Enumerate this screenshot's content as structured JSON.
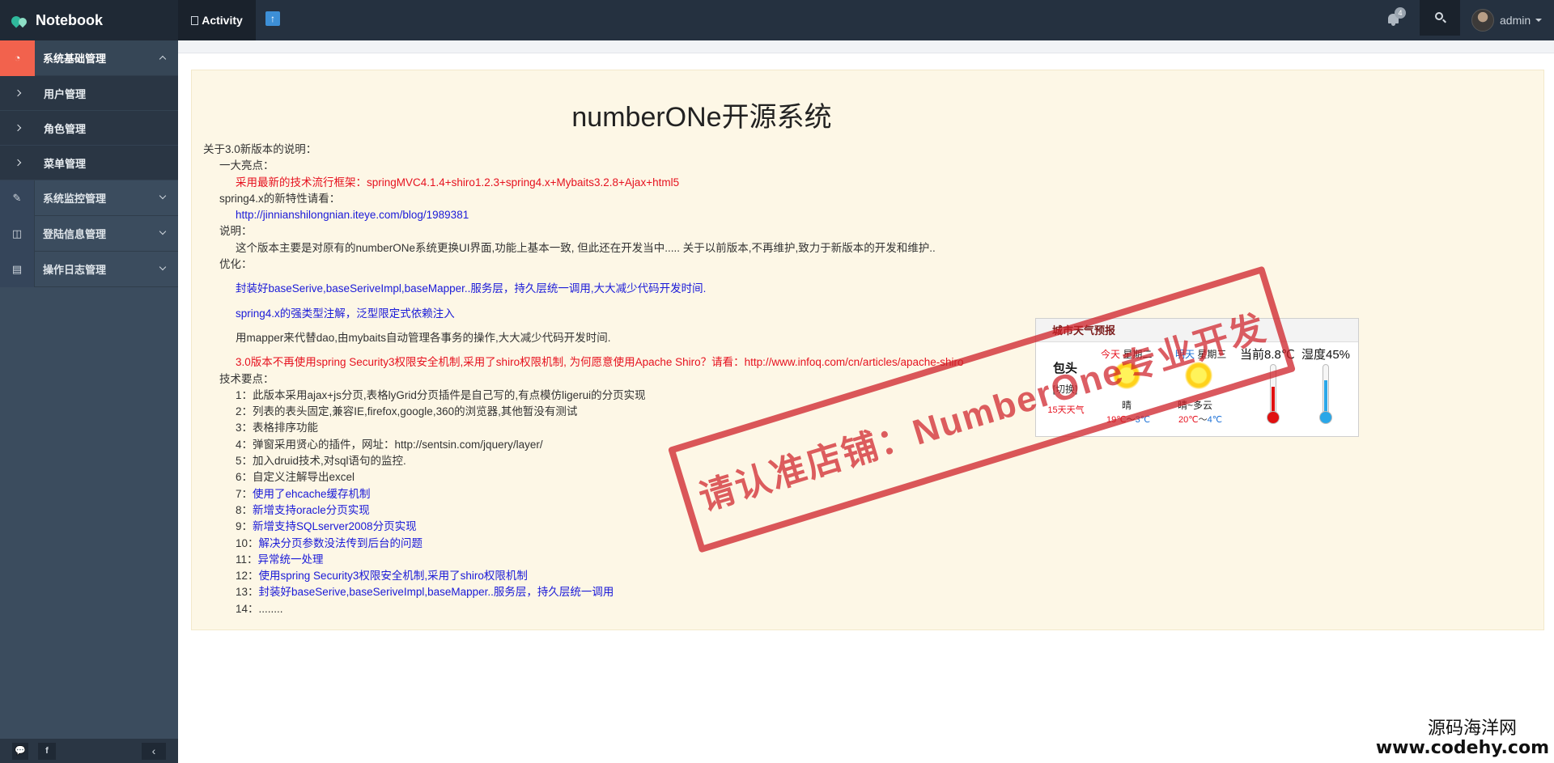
{
  "brand": {
    "title": "Notebook"
  },
  "topnav": {
    "activity_label": "Activity",
    "upload_glyph": "↑",
    "notification_count": "4",
    "user_name": "admin"
  },
  "sidebar": {
    "groups": [
      {
        "label": "系统基础管理",
        "icon": "dashboard-icon",
        "expanded": true,
        "items": [
          {
            "label": "用户管理"
          },
          {
            "label": "角色管理"
          },
          {
            "label": "菜单管理"
          }
        ]
      },
      {
        "label": "系统监控管理",
        "icon": "edit-icon"
      },
      {
        "label": "登陆信息管理",
        "icon": "columns-icon"
      },
      {
        "label": "操作日志管理",
        "icon": "book-icon"
      }
    ],
    "footer": {
      "chat_glyph": "💬",
      "facebook_glyph": "f",
      "collapse_glyph": "‹"
    }
  },
  "content": {
    "title": "numberONe开源系统",
    "lines": [
      "关于3.0新版本的说明：",
      "一大亮点：",
      "采用最新的技术流行框架：springMVC4.1.4+shiro1.2.3+spring4.x+Mybaits3.2.8+Ajax+html5",
      "spring4.x的新特性请看：",
      "http://jinnianshilongnian.iteye.com/blog/1989381",
      "说明：",
      "这个版本主要是对原有的numberONe系统更换UI界面,功能上基本一致, 但此还在开发当中..... 关于以前版本,不再维护,致力于新版本的开发和维护..",
      "优化：",
      "封装好baseSerive,baseSeriveImpl,baseMapper..服务层，持久层统一调用,大大减少代码开发时间.",
      "spring4.x的强类型注解，泛型限定式依赖注入",
      "用mapper来代替dao,由mybaits自动管理各事务的操作,大大减少代码开发时间.",
      "3.0版本不再使用spring Security3权限安全机制,采用了shiro权限机制, 为何愿意使用Apache Shiro？请看：http://www.infoq.com/cn/articles/apache-shiro",
      "技术要点：",
      "1：此版本采用ajax+js分页,表格lyGrid分页插件是自己写的,有点模仿ligerui的分页实现",
      "2：列表的表头固定,兼容IE,firefox,google,360的浏览器,其他暂没有测试",
      "3：表格排序功能",
      "4：弹窗采用贤心的插件，网址：http://sentsin.com/jquery/layer/",
      "5：加入druid技术,对sql语句的监控.",
      "6：自定义注解导出excel"
    ],
    "list": [
      {
        "num": "7：",
        "text": "使用了ehcache缓存机制"
      },
      {
        "num": "8：",
        "text": "新增支持oracle分页实现"
      },
      {
        "num": "9：",
        "text": "新增支持SQLserver2008分页实现"
      },
      {
        "num": "10：",
        "text": "解决分页参数没法传到后台的问题"
      },
      {
        "num": "11：",
        "text": "异常统一处理"
      },
      {
        "num": "12：",
        "text": "使用spring Security3权限安全机制,采用了shiro权限机制"
      },
      {
        "num": "13：",
        "text": "封装好baseSerive,baseSeriveImpl,baseMapper..服务层，持久层统一调用"
      },
      {
        "num": "14：",
        "text": "........"
      }
    ]
  },
  "stamp": {
    "text": "请认准店铺：NumberOne专业开发"
  },
  "weather": {
    "header": "城市天气预报",
    "city": "包头",
    "switch_label": "[切换]",
    "fifteen_day": "15天天气",
    "today": {
      "tag": "今天",
      "weekday": "星期二",
      "desc": "晴",
      "high": "19℃",
      "sep": "～",
      "low": "3℃"
    },
    "tomorrow": {
      "tag": "明天",
      "weekday": "星期三",
      "desc": "晴~多云",
      "high": "20℃",
      "sep": "～",
      "low": "4℃"
    },
    "current_temp": "当前8.8℃",
    "humidity": "湿度45%"
  },
  "watermark": {
    "line1": "源码海洋网",
    "line2": "www.codehy.com"
  },
  "colors": {
    "accent": "#f2624d",
    "sidebar": "#3b4c5e",
    "topbar": "#253140",
    "panel": "#fdf7e6",
    "link_blue": "#1a1ad8",
    "alert_red": "#e6121f"
  }
}
